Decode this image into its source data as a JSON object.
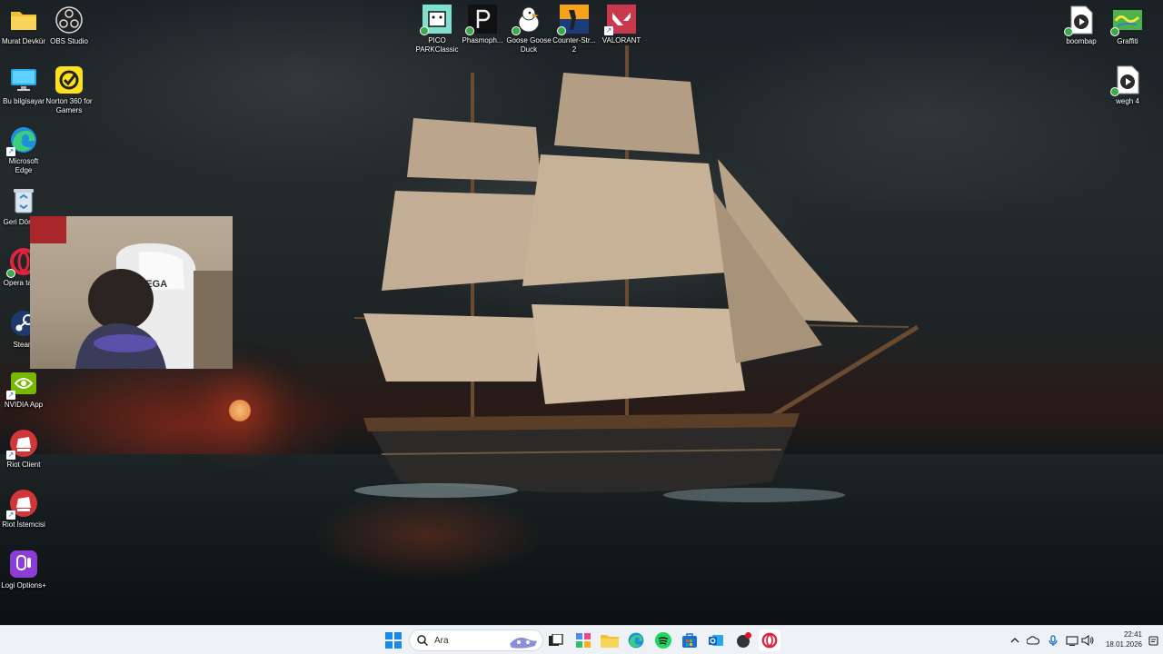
{
  "desktop": {
    "left_icons": [
      {
        "label": "Murat Devkür",
        "icon": "folder-icon"
      },
      {
        "label": "OBS Studio",
        "icon": "obs-icon"
      },
      {
        "label": "Bu bilgisayar",
        "icon": "monitor-icon"
      },
      {
        "label": "Norton 360 for Gamers",
        "icon": "norton-icon"
      },
      {
        "label": "Microsoft Edge",
        "icon": "edge-icon"
      },
      {
        "label": "Geri Dönüşü",
        "icon": "recycle-bin-icon"
      },
      {
        "label": "Opera tarayı",
        "icon": "opera-icon"
      },
      {
        "label": "Steam",
        "icon": "steam-icon"
      },
      {
        "label": "NVIDIA App",
        "icon": "nvidia-icon"
      },
      {
        "label": "Riot Client",
        "icon": "riot-icon"
      },
      {
        "label": "Riot İstemcisi",
        "icon": "riot-icon"
      },
      {
        "label": "Logi Options+",
        "icon": "logi-icon"
      }
    ],
    "top_icons": [
      {
        "label": "PICO PARKClassic",
        "icon": "pico-park-icon"
      },
      {
        "label": "Phasmoph...",
        "icon": "phasmophobia-icon"
      },
      {
        "label": "Goose Goose Duck",
        "icon": "goose-icon"
      },
      {
        "label": "Counter-Str... 2",
        "icon": "counter-strike-icon"
      },
      {
        "label": "VALORANT",
        "icon": "valorant-icon"
      }
    ],
    "right_icons": [
      {
        "label": "boombap",
        "icon": "audio-file-icon"
      },
      {
        "label": "Graffiti",
        "icon": "graffiti-icon"
      },
      {
        "label": "wegh 4",
        "icon": "audio-file-icon"
      }
    ],
    "webcam_text": "VEGA"
  },
  "taskbar": {
    "search_placeholder": "Ara",
    "pinned": [
      "start-icon",
      "task-view-icon",
      "copilot-icon",
      "file-explorer-icon",
      "edge-icon",
      "spotify-icon",
      "store-icon",
      "outlook-icon",
      "notification-app-icon",
      "opera-icon"
    ],
    "tray": [
      "chevron-up-icon",
      "onedrive-icon",
      "microphone-icon",
      "network-icon",
      "volume-icon"
    ],
    "time": "22:41",
    "date": "18.01.2026"
  },
  "colors": {
    "taskbar_bg": "#eef1f6",
    "accent": "#0078d4"
  }
}
